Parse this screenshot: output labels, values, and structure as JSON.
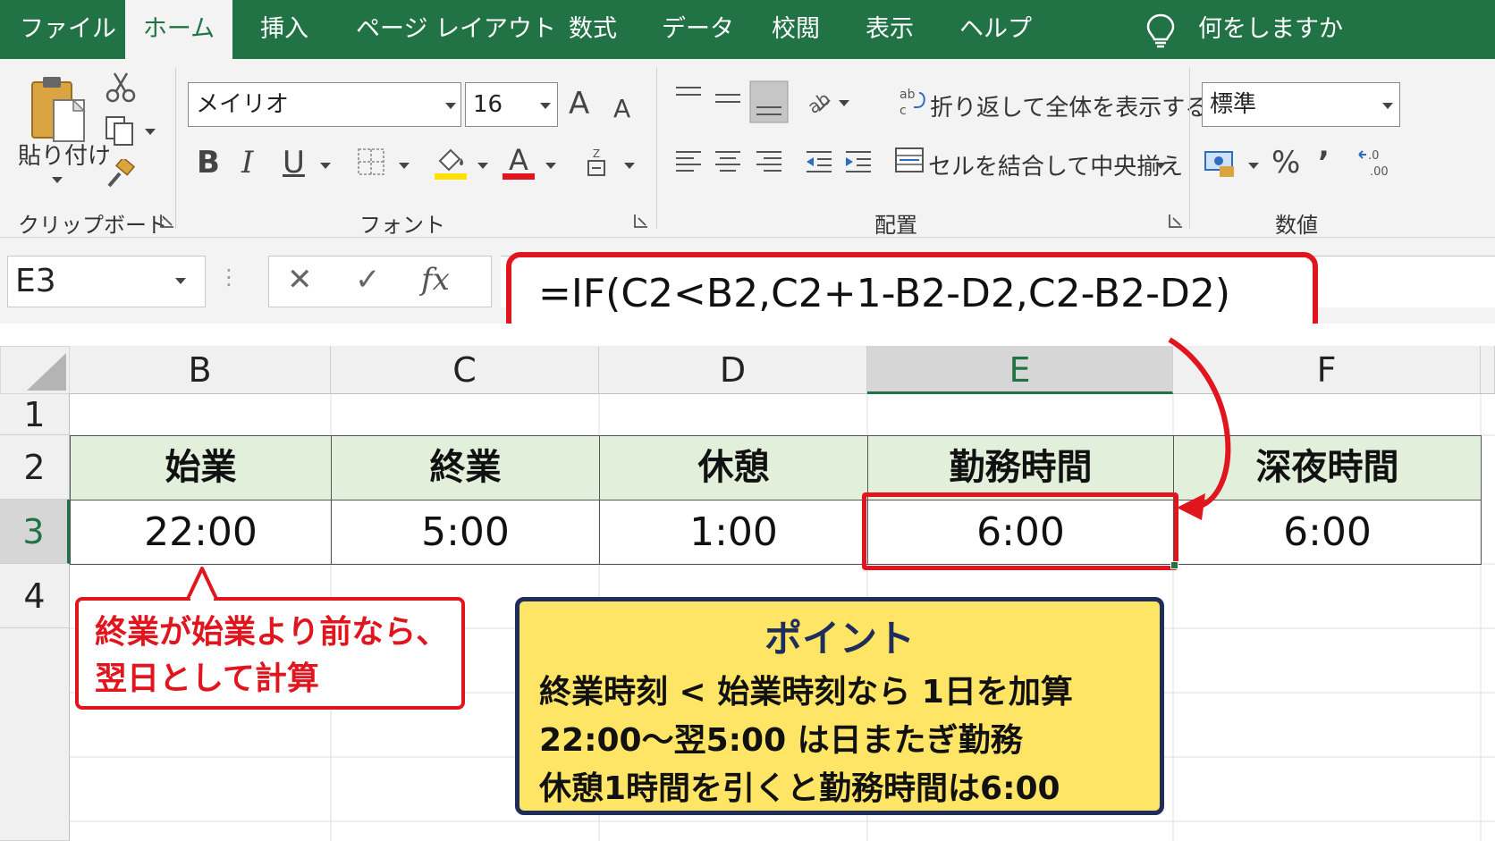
{
  "menu": {
    "tabs": [
      "ファイル",
      "ホーム",
      "挿入",
      "ページ レイアウト",
      "数式",
      "データ",
      "校閲",
      "表示",
      "ヘルプ"
    ],
    "search": "何をしますか"
  },
  "ribbon": {
    "clipboard": {
      "paste": "貼り付け",
      "label": "クリップボード"
    },
    "font": {
      "name": "メイリオ",
      "size": "16",
      "bold": "B",
      "italic": "I",
      "underline": "U",
      "label": "フォント",
      "grow": "A",
      "shrink": "A"
    },
    "alignment": {
      "wrap": "折り返して全体を表示する",
      "merge": "セルを結合して中央揃え",
      "label": "配置"
    },
    "number": {
      "format": "標準",
      "percent": "%",
      "comma": "’",
      "label": "数値"
    },
    "colors": {
      "highlight": "#ffe000",
      "font_color": "#e0151d"
    }
  },
  "formula_bar": {
    "name_box": "E3",
    "cancel": "✕",
    "enter": "✓",
    "fx": "fx",
    "formula": "=IF(C2<B2,C2+1-B2-D2,C2-B2-D2)"
  },
  "grid": {
    "columns": [
      "B",
      "C",
      "D",
      "E",
      "F"
    ],
    "selected_column": "E",
    "rows": [
      "1",
      "2",
      "3",
      "4"
    ],
    "selected_row": "3",
    "headers": [
      "始業",
      "終業",
      "休憩",
      "勤務時間",
      "深夜時間"
    ],
    "values": [
      "22:00",
      "5:00",
      "1:00",
      "6:00",
      "6:00"
    ]
  },
  "callout": {
    "text": "終業が始業より前なら、\n翌日として計算"
  },
  "point": {
    "title": "ポイント",
    "lines": [
      "終業時刻 < 始業時刻なら 1日を加算",
      "22:00〜翌5:00 は日またぎ勤務",
      "休憩1時間を引くと勤務時間は6:00"
    ]
  },
  "accent_colors": {
    "excel_green": "#217346",
    "callout_red": "#e0151d",
    "point_yellow": "#ffe566",
    "point_navy": "#1f2d5a"
  }
}
